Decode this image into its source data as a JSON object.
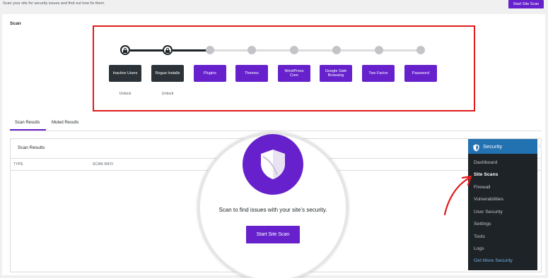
{
  "header": {
    "description": "Scan your site for security issues and find out how fix them.",
    "start_scan_label": "Start Site Scan"
  },
  "scan": {
    "title": "Scan",
    "steps": [
      {
        "label": "Inactive Users",
        "state": "locked",
        "sub": "Unlock"
      },
      {
        "label": "Rogue Installs",
        "state": "locked",
        "sub": "Unlock"
      },
      {
        "label": "Plugins",
        "state": "available"
      },
      {
        "label": "Themes",
        "state": "available"
      },
      {
        "label": "WordPress Core",
        "state": "available"
      },
      {
        "label": "Google Safe Browsing",
        "state": "available"
      },
      {
        "label": "Two Factor",
        "state": "available"
      },
      {
        "label": "Password",
        "state": "available"
      }
    ]
  },
  "tabs": [
    {
      "label": "Scan Results",
      "active": true
    },
    {
      "label": "Muted Results",
      "active": false
    }
  ],
  "results": {
    "title": "Scan Results",
    "columns": [
      "TYPE",
      "SCAN INFO"
    ]
  },
  "magnifier": {
    "message": "Scan to find issues with your site’s security.",
    "button_label": "Start Site Scan",
    "icon": "shield-icon"
  },
  "menu": {
    "header_label": "Security",
    "header_icon": "shield-icon",
    "items": [
      {
        "label": "Dashboard",
        "current": false
      },
      {
        "label": "Site Scans",
        "current": true
      },
      {
        "label": "Firewall",
        "current": false
      },
      {
        "label": "Vulnerabilities",
        "current": false
      },
      {
        "label": "User Security",
        "current": false
      },
      {
        "label": "Settings",
        "current": false
      },
      {
        "label": "Tools",
        "current": false
      },
      {
        "label": "Logs",
        "current": false
      },
      {
        "label": "Get More Security",
        "current": false,
        "promo": true
      }
    ]
  },
  "colors": {
    "accent": "#6621cc",
    "admin_blue": "#2271b1",
    "highlight_border": "#e01b1b",
    "annotation_arrow": "#e01b1b"
  }
}
